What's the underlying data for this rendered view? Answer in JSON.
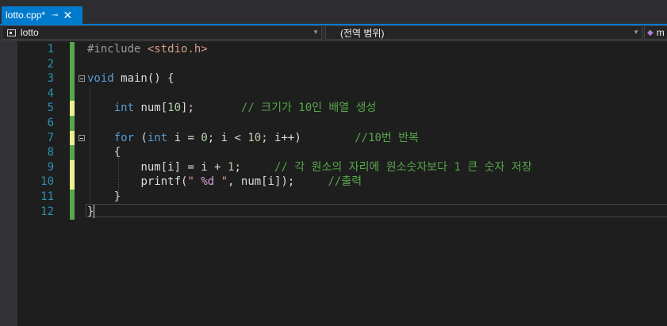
{
  "tab": {
    "title": "lotto.cpp*",
    "pin_glyph": "⊸",
    "close_glyph": "✕"
  },
  "navbar": {
    "project": "lotto",
    "scope": "(전역 범위)",
    "member": "m"
  },
  "icons": {
    "project": "cpp-project-icon",
    "member": "member-function-icon",
    "fold": "collapse-toggle-icon",
    "dropdown": "chevron-down-icon"
  },
  "colors": {
    "accent": "#007acc",
    "background": "#1e1e1e",
    "line_number": "#2b91af",
    "keyword": "#569cd6",
    "comment": "#57a64a",
    "string": "#d69d85",
    "number": "#b5cea8",
    "saved_change": "#57a64a",
    "unsaved_change": "#efef91"
  },
  "lines": [
    {
      "num": "1",
      "change": "saved"
    },
    {
      "num": "2",
      "change": "saved"
    },
    {
      "num": "3",
      "change": "saved",
      "fold": true
    },
    {
      "num": "4",
      "change": "saved"
    },
    {
      "num": "5",
      "change": "unsaved"
    },
    {
      "num": "6",
      "change": "saved"
    },
    {
      "num": "7",
      "change": "unsaved",
      "fold": true
    },
    {
      "num": "8",
      "change": "saved"
    },
    {
      "num": "9",
      "change": "unsaved"
    },
    {
      "num": "10",
      "change": "unsaved"
    },
    {
      "num": "11",
      "change": "saved"
    },
    {
      "num": "12",
      "change": "saved"
    }
  ],
  "code": {
    "l1_directive": "#include ",
    "l1_header": "<stdio.h>",
    "l3_kw": "void",
    "l3_rest": " main() {",
    "l5_kw": "int",
    "l5_rest": " num[",
    "l5_num": "10",
    "l5_end": "];",
    "l5_comment": "// 크기가 10인 배열 생성",
    "l7_for": "for",
    "l7_open": " (",
    "l7_int": "int",
    "l7_a": " i = ",
    "l7_zero": "0",
    "l7_b": "; i < ",
    "l7_ten": "10",
    "l7_c": "; i++)",
    "l7_comment": "//10번 반복",
    "l8_brace": "{",
    "l9_a": "num[i] = i + ",
    "l9_one": "1",
    "l9_semi": ";",
    "l9_comment": "// 각 원소의 자리에 원소숫자보다 1 큰 숫자 저장",
    "l10_fn": "printf(",
    "l10_str_a": "\" ",
    "l10_fmt": "%d",
    "l10_str_b": " \"",
    "l10_rest": ", num[i]);",
    "l10_comment": "//출력",
    "l11_brace": "}",
    "l12_brace": "}"
  }
}
